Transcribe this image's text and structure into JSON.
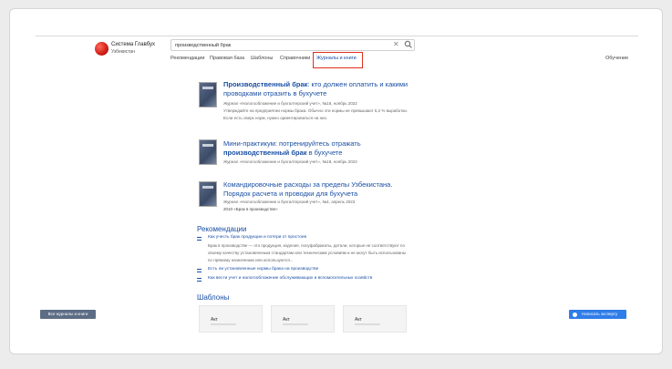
{
  "header": {
    "brand_line1": "Система Главбух",
    "brand_line2": "Узбекистан",
    "search_value": "производственный брак",
    "learning_link": "Обучение"
  },
  "nav": [
    {
      "label": "Рекомендации"
    },
    {
      "label": "Правовая база"
    },
    {
      "label": "Шаблоны"
    },
    {
      "label": "Справочники"
    },
    {
      "label": "Журналы и книги",
      "active": true
    }
  ],
  "articles": [
    {
      "title_bold": "Производственный брак",
      "title_rest": ": кто должен оплатить и какими проводками отразить в бухучете",
      "meta": "Журнал «Налогообложение и бухгалтерский учет», №18, ноябрь 2022",
      "snippet": "Утверждайте на предприятии нормы брака. Обычно эти нормы не превышают 5,2 % выработки. Если есть сверх норм, нужно ориентироваться на них."
    },
    {
      "title_pre": "Мини-практикум: потренируйтесь отражать ",
      "title_bold": "производственный брак",
      "title_rest": " в бухучете",
      "meta": "Журнал «Налогообложение и бухгалтерский учет», №18, ноябрь 2022"
    },
    {
      "title": "Командировочные расходы за пределы Узбекистана. Порядок расчета и проводки для бухучета",
      "meta": "Журнал «Налогообложение и бухгалтерский учет», №4, апрель 2023",
      "extra": "2010 «Брак в производстве»"
    }
  ],
  "recommendations": {
    "heading": "Рекомендации",
    "items": [
      {
        "link": "Как учесть брак продукции и потери от простоев",
        "text": "Брак в производстве — это продукция, изделия, полуфабрикаты, детали, которые не соответствуют по своему качеству установленным стандартам или техническим условиям и не могут быть использованы по прямому назначению или используются..."
      },
      {
        "link": "Есть ли установленные нормы брака на производстве"
      },
      {
        "link": "Как вести учет и налогообложение обслуживающих и вспомогательных хозяйств"
      }
    ]
  },
  "templates": {
    "heading": "Шаблоны",
    "cards": [
      {
        "label": "Акт"
      },
      {
        "label": "Акт"
      },
      {
        "label": "Акт"
      }
    ]
  },
  "buttons": {
    "all_journals": "Все журналы и книги",
    "write_expert": "Написать эксперту"
  },
  "colors": {
    "accent": "#1a4fa3",
    "highlight_box": "#e0301e",
    "primary_button": "#2f7de8"
  }
}
